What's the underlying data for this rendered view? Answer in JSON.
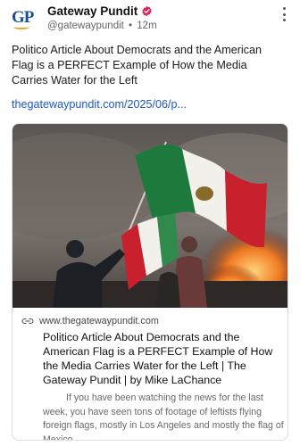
{
  "post": {
    "author_name": "Gateway Pundit",
    "avatar_text": "GP",
    "handle": "@gatewaypundit",
    "separator": "•",
    "time": "12m",
    "text": "Politico Article About Democrats and the American Flag is a PERFECT Example of How the Media Carries Water for the Left",
    "link_text": "thegatewaypundit.com/2025/06/p..."
  },
  "card": {
    "domain": "www.thegatewaypundit.com",
    "title": "Politico Article About Democrats and the American Flag is a PERFECT Example of How the Media Carries Water for the Left | The Gateway Pundit | by Mike LaChance",
    "description": "If you have been watching the news for the last week, you have seen tons of footage of leftists flying foreign flags, mostly in Los Angeles and mostly the flag of Mexico."
  },
  "icons": {
    "verified": "verified-badge-icon",
    "more": "more-vertical-icon",
    "link": "link-icon"
  },
  "colors": {
    "link": "#1d57c6",
    "verified": "#e0245e",
    "logo_blue": "#1b4d9b",
    "logo_accent": "#e8a11c"
  }
}
